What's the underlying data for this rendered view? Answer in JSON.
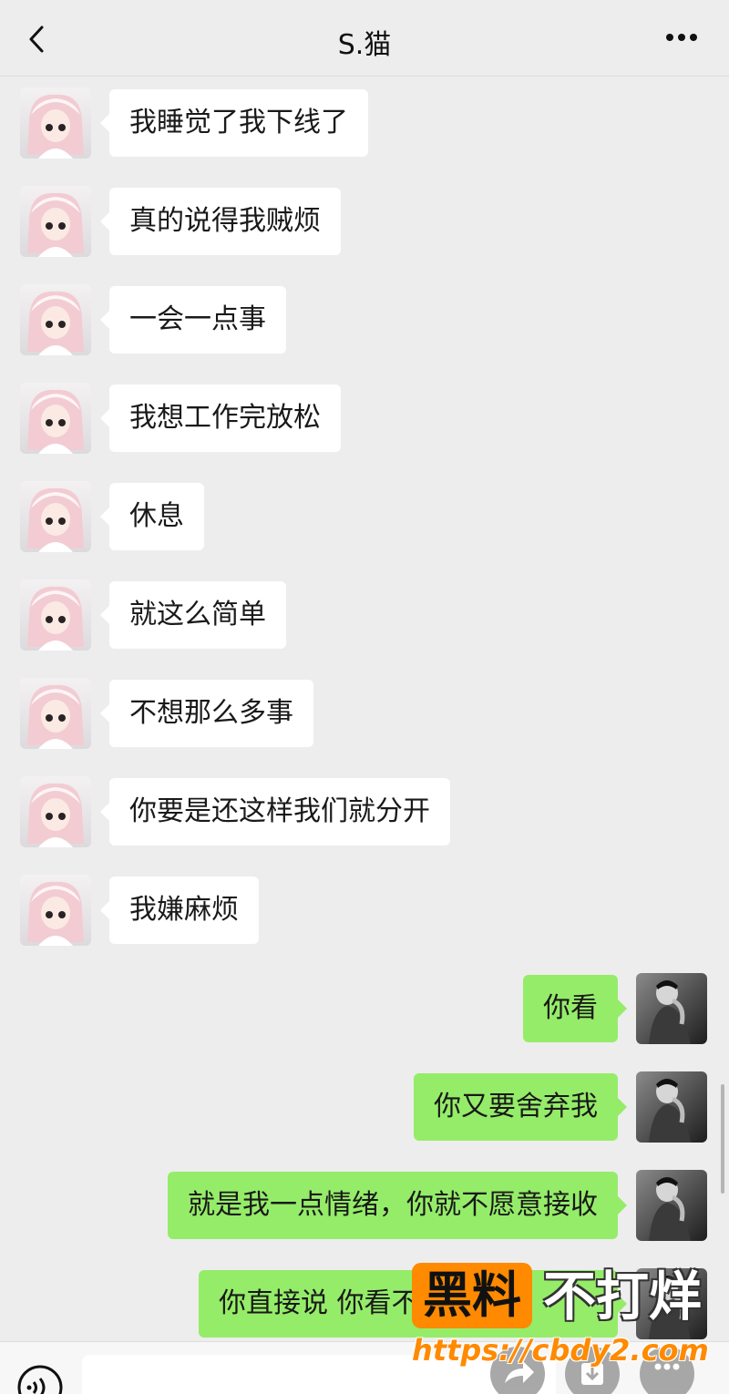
{
  "header": {
    "title": "S.猫",
    "back_icon": "back-chevron-icon",
    "more_icon": "more-dots-icon"
  },
  "messages": [
    {
      "side": "received",
      "text": "我睡觉了我下线了"
    },
    {
      "side": "received",
      "text": "真的说得我贼烦"
    },
    {
      "side": "received",
      "text": "一会一点事"
    },
    {
      "side": "received",
      "text": "我想工作完放松"
    },
    {
      "side": "received",
      "text": "休息"
    },
    {
      "side": "received",
      "text": "就这么简单"
    },
    {
      "side": "received",
      "text": "不想那么多事"
    },
    {
      "side": "received",
      "text": "你要是还这样我们就分开"
    },
    {
      "side": "received",
      "text": "我嫌麻烦"
    },
    {
      "side": "sent",
      "text": "你看"
    },
    {
      "side": "sent",
      "text": "你又要舍弃我"
    },
    {
      "side": "sent",
      "text": "就是我一点情绪，你就不愿意接收"
    },
    {
      "side": "sent",
      "text": "你直接说 你看不"
    }
  ],
  "watermark": {
    "badge": "黑料",
    "text": "不打烊",
    "url": "https://cbdy2.com"
  },
  "colors": {
    "background": "#ededed",
    "sent_bubble": "#95ec69",
    "received_bubble": "#ffffff",
    "watermark_orange": "#ff8a00"
  }
}
